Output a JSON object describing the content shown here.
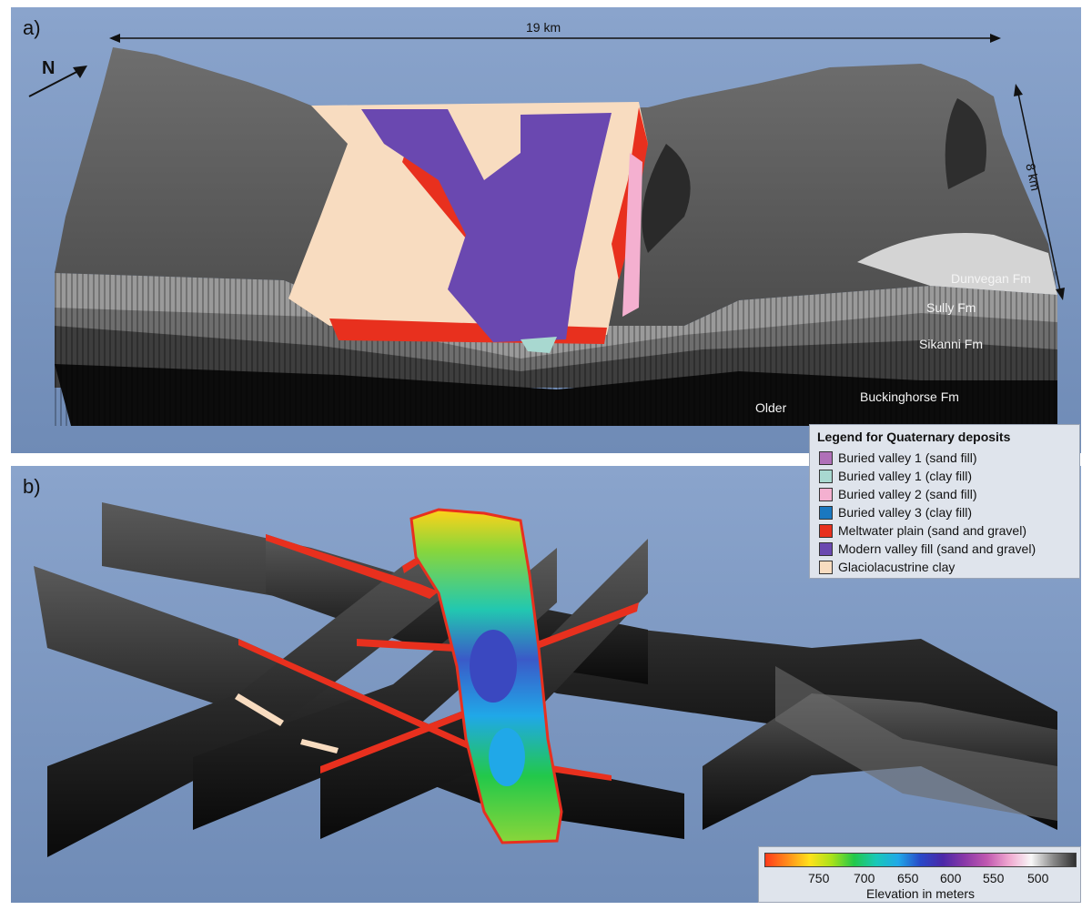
{
  "panel_a": {
    "label": "a)",
    "north": "N",
    "width_scale": "19 km",
    "depth_scale": "8 km",
    "formations": [
      "Dunvegan Fm",
      "Sully Fm",
      "Sikanni Fm",
      "Buckinghorse Fm",
      "Older"
    ]
  },
  "panel_b": {
    "label": "b)"
  },
  "legend": {
    "title": "Legend for Quaternary deposits",
    "items": [
      {
        "label": "Buried valley 1 (sand fill)",
        "color": "#b070b8"
      },
      {
        "label": "Buried valley 1 (clay fill)",
        "color": "#a8d8d0"
      },
      {
        "label": "Buried valley 2 (sand fill)",
        "color": "#f4b0d0"
      },
      {
        "label": "Buried valley 3 (clay fill)",
        "color": "#1a78c0"
      },
      {
        "label": "Meltwater plain (sand and gravel)",
        "color": "#e8301e"
      },
      {
        "label": "Modern valley fill (sand and gravel)",
        "color": "#6a48b0"
      },
      {
        "label": "Glaciolacustrine clay",
        "color": "#f8dcc0"
      }
    ]
  },
  "colorbar": {
    "ticks": [
      "750",
      "700",
      "650",
      "600",
      "550",
      "500"
    ],
    "caption": "Elevation in meters"
  }
}
